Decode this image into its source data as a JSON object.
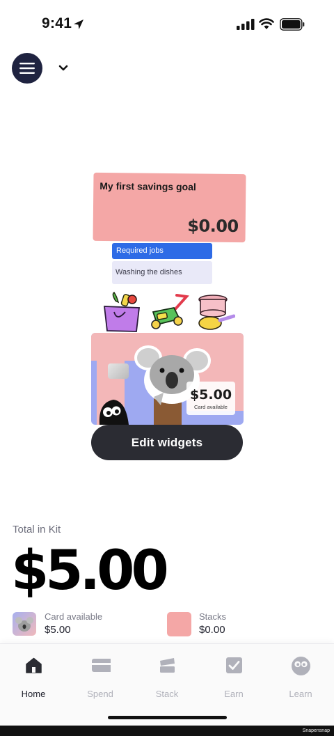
{
  "status_bar": {
    "time": "9:41"
  },
  "widgets": {
    "savings_goal": {
      "title": "My first savings goal",
      "amount": "$0.00"
    },
    "jobs": {
      "header": "Required jobs",
      "item": "Washing the dishes"
    },
    "kit_card": {
      "balance": "$5.00",
      "balance_label": "Card available"
    },
    "edit_button_label": "Edit widgets"
  },
  "totals": {
    "label": "Total in Kit",
    "amount": "$5.00",
    "card_available": {
      "label": "Card available",
      "value": "$5.00"
    },
    "stacks": {
      "label": "Stacks",
      "value": "$0.00"
    }
  },
  "tabs": [
    {
      "label": "Home",
      "icon": "home-icon",
      "active": true
    },
    {
      "label": "Spend",
      "icon": "card-icon",
      "active": false
    },
    {
      "label": "Stack",
      "icon": "stack-icon",
      "active": false
    },
    {
      "label": "Earn",
      "icon": "checkbox-icon",
      "active": false
    },
    {
      "label": "Learn",
      "icon": "owl-icon",
      "active": false
    }
  ],
  "watermark": "Snapensnap",
  "colors": {
    "menu_button": "#1f2340",
    "goal_card": "#f4a7a6",
    "jobs_header": "#2e6be6",
    "kit_card_blue": "#9ea9f1",
    "kit_card_pink": "#f3b7b8",
    "edit_button": "#2b2c33"
  }
}
